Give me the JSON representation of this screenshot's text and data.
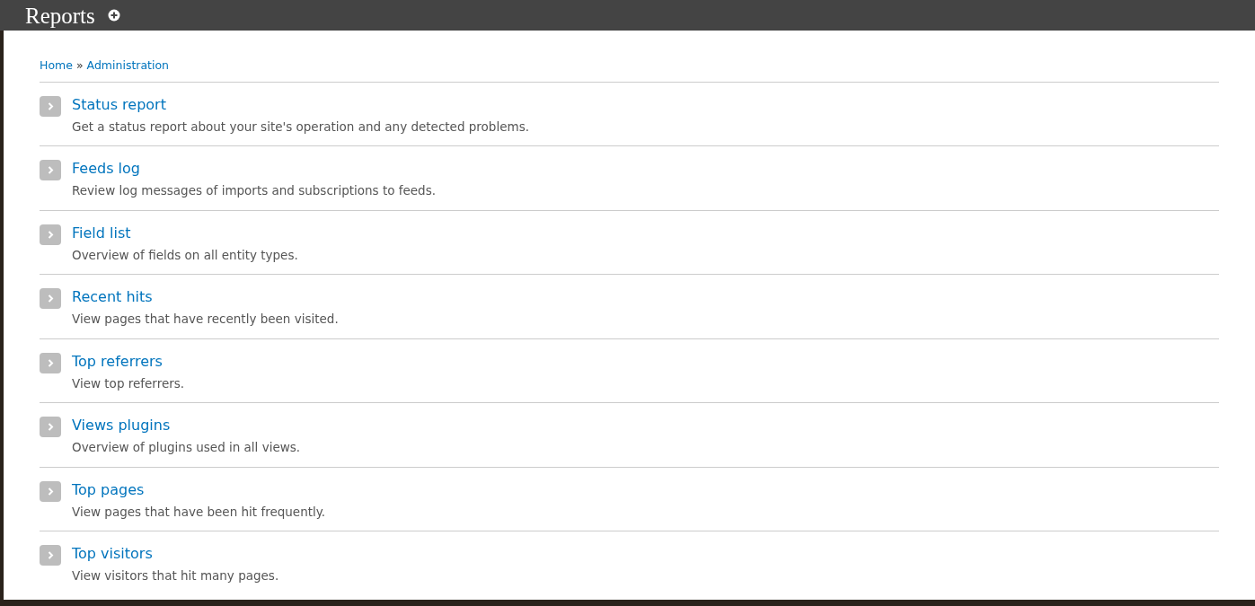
{
  "page_title": "Reports",
  "breadcrumb": [
    {
      "label": "Home"
    },
    {
      "label": "Administration"
    }
  ],
  "breadcrumb_separator": "»",
  "items": [
    {
      "title": "Status report",
      "description": "Get a status report about your site's operation and any detected problems."
    },
    {
      "title": "Feeds log",
      "description": "Review log messages of imports and subscriptions to feeds."
    },
    {
      "title": "Field list",
      "description": "Overview of fields on all entity types."
    },
    {
      "title": "Recent hits",
      "description": "View pages that have recently been visited."
    },
    {
      "title": "Top referrers",
      "description": "View top referrers."
    },
    {
      "title": "Views plugins",
      "description": "Overview of plugins used in all views."
    },
    {
      "title": "Top pages",
      "description": "View pages that have been hit frequently."
    },
    {
      "title": "Top visitors",
      "description": "View visitors that hit many pages."
    }
  ]
}
